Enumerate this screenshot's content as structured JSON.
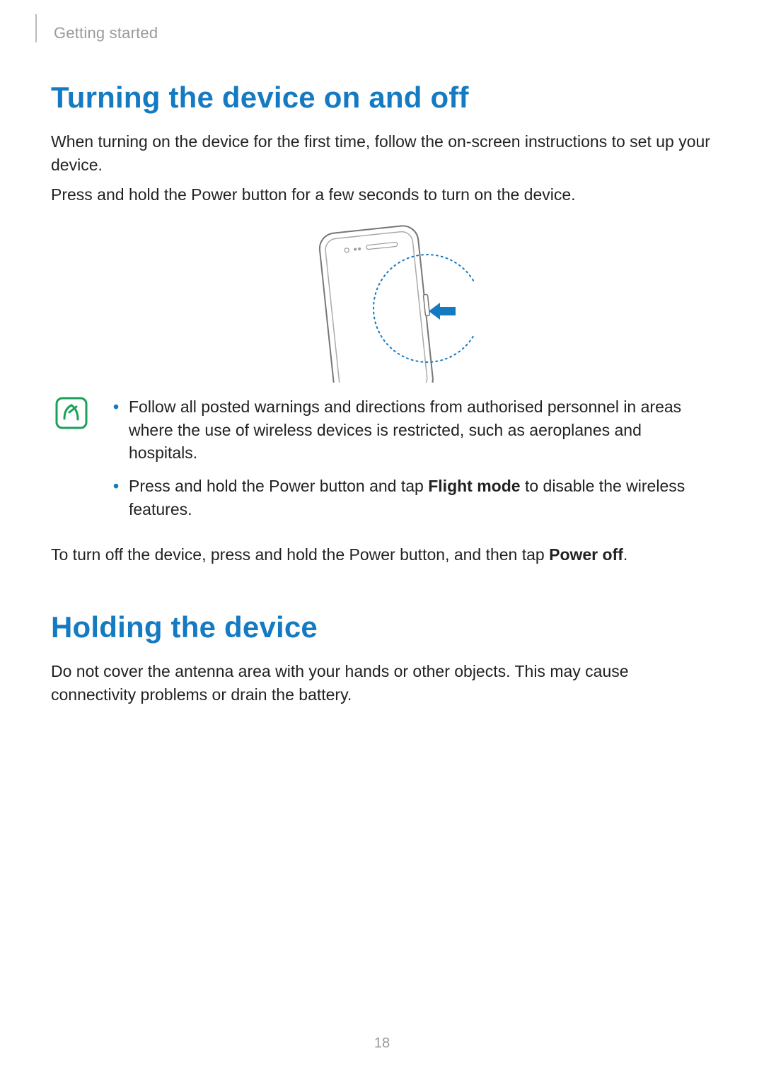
{
  "runhead": "Getting started",
  "section1": {
    "title": "Turning the device on and off",
    "p1": "When turning on the device for the first time, follow the on-screen instructions to set up your device.",
    "p2": "Press and hold the Power button for a few seconds to turn on the device.",
    "note": {
      "li1": "Follow all posted warnings and directions from authorised personnel in areas where the use of wireless devices is restricted, such as aeroplanes and hospitals.",
      "li2_a": "Press and hold the Power button and tap ",
      "li2_b": "Flight mode",
      "li2_c": " to disable the wireless features."
    },
    "p3_a": "To turn off the device, press and hold the Power button, and then tap ",
    "p3_b": "Power off",
    "p3_c": "."
  },
  "section2": {
    "title": "Holding the device",
    "p1": "Do not cover the antenna area with your hands or other objects. This may cause connectivity problems or drain the battery."
  },
  "page_number": "18"
}
